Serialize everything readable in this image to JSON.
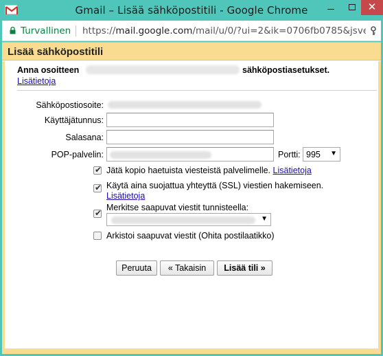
{
  "window": {
    "title": "Gmail – Lisää sähköpostitili - Google Chrome",
    "close_glyph": "✕"
  },
  "addressbar": {
    "secure_label": "Turvallinen",
    "url_scheme": "https://",
    "url_host": "mail.google.com",
    "url_path": "/mail/u/0/?ui=2&ik=0706fb0785&jsver..."
  },
  "page": {
    "header_title": "Lisää sähköpostitili",
    "intro_start": "Anna osoitteen",
    "intro_end": "sähköpostiasetukset.",
    "learn_more": "Lisätietoja"
  },
  "form": {
    "email_label": "Sähköpostiosoite:",
    "username_label": "Käyttäjätunnus:",
    "username_value": "",
    "password_label": "Salasana:",
    "password_value": "",
    "pop_label": "POP-palvelin:",
    "port_label": "Portti:",
    "port_value": "995"
  },
  "options": {
    "leave_copy": "Jätä kopio haetuista viesteistä palvelimelle.",
    "leave_copy_link": "Lisätietoja",
    "leave_copy_checked": true,
    "ssl": "Käytä aina suojattua yhteyttä (SSL) viestien hakemiseen.",
    "ssl_link": "Lisätietoja",
    "ssl_checked": true,
    "label_incoming": "Merkitse saapuvat viestit tunnisteella:",
    "label_incoming_checked": true,
    "archive": "Arkistoi saapuvat viestit (Ohita postilaatikko)",
    "archive_checked": false
  },
  "buttons": {
    "cancel": "Peruuta",
    "back": "« Takaisin",
    "add": "Lisää tili »"
  },
  "colors": {
    "frame": "#4fc6b9",
    "header": "#f9dc8f",
    "link": "#1a0dab",
    "secure": "#0b8043"
  }
}
